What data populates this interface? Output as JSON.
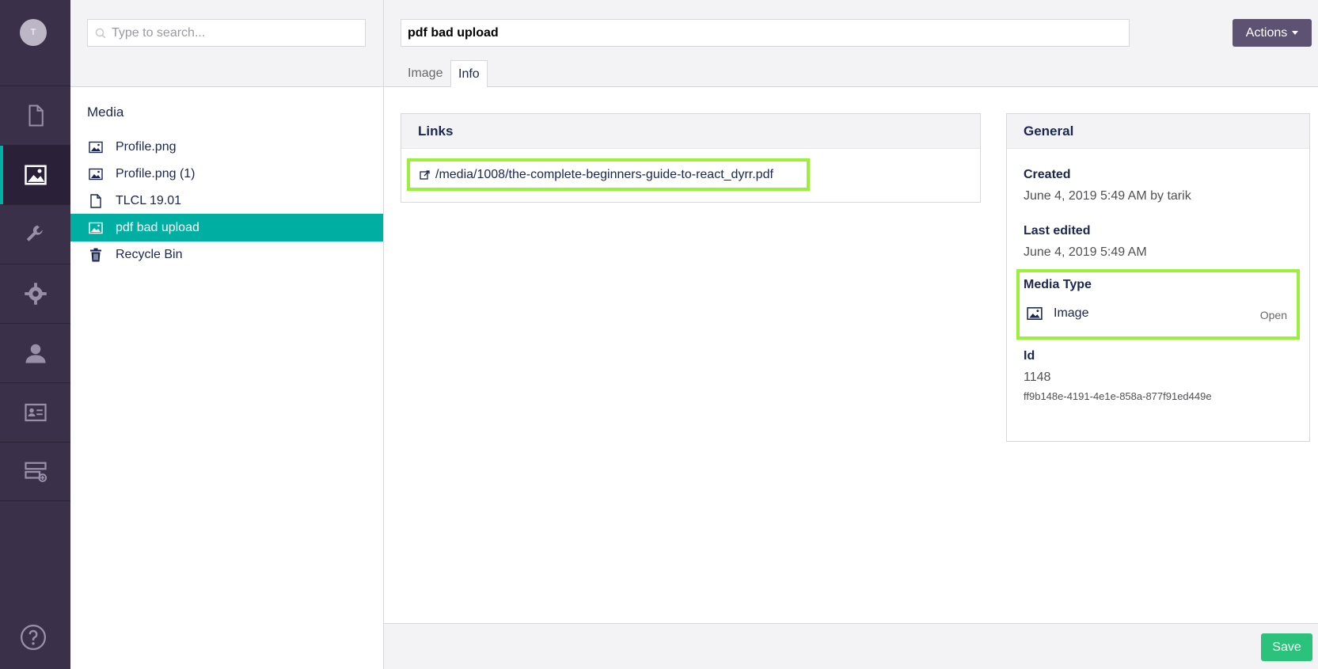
{
  "user": {
    "avatar_initial": "T"
  },
  "rail": {
    "sections": [
      {
        "name": "content",
        "icon": "document-icon",
        "active": false
      },
      {
        "name": "media",
        "icon": "image-icon",
        "active": true
      },
      {
        "name": "settings",
        "icon": "wrench-icon",
        "active": false
      },
      {
        "name": "packages",
        "icon": "gear-icon",
        "active": false
      },
      {
        "name": "users",
        "icon": "user-icon",
        "active": false
      },
      {
        "name": "members",
        "icon": "id-card-icon",
        "active": false
      },
      {
        "name": "forms",
        "icon": "forms-icon",
        "active": false
      }
    ],
    "help_icon": "help-icon"
  },
  "search": {
    "placeholder": "Type to search..."
  },
  "tree": {
    "title": "Media",
    "items": [
      {
        "label": "Profile.png",
        "icon": "image-icon"
      },
      {
        "label": "Profile.png (1)",
        "icon": "image-icon"
      },
      {
        "label": "TLCL 19.01",
        "icon": "document-icon"
      },
      {
        "label": "pdf bad upload",
        "icon": "image-icon",
        "selected": true
      },
      {
        "label": "Recycle Bin",
        "icon": "trash-icon"
      }
    ]
  },
  "header": {
    "name_value": "pdf bad upload",
    "actions_label": "Actions",
    "tabs": [
      {
        "label": "Image",
        "active": false
      },
      {
        "label": "Info",
        "active": true
      }
    ]
  },
  "links": {
    "title": "Links",
    "url": "/media/1008/the-complete-beginners-guide-to-react_dyrr.pdf"
  },
  "general": {
    "title": "General",
    "created_label": "Created",
    "created_value": "June 4, 2019 5:49 AM by tarik",
    "edited_label": "Last edited",
    "edited_value": "June 4, 2019 5:49 AM",
    "media_type_label": "Media Type",
    "media_type_value": "Image",
    "media_type_open": "Open",
    "id_label": "Id",
    "id_value": "1148",
    "guid_value": "ff9b148e-4191-4e1e-858a-877f91ed449e"
  },
  "footer": {
    "save_label": "Save"
  },
  "colors": {
    "rail_bg": "#3b3049",
    "accent_teal": "#00aea2",
    "highlight_green": "#9cf03c",
    "save_green": "#2bc37c",
    "actions_purple": "#5e5273"
  }
}
